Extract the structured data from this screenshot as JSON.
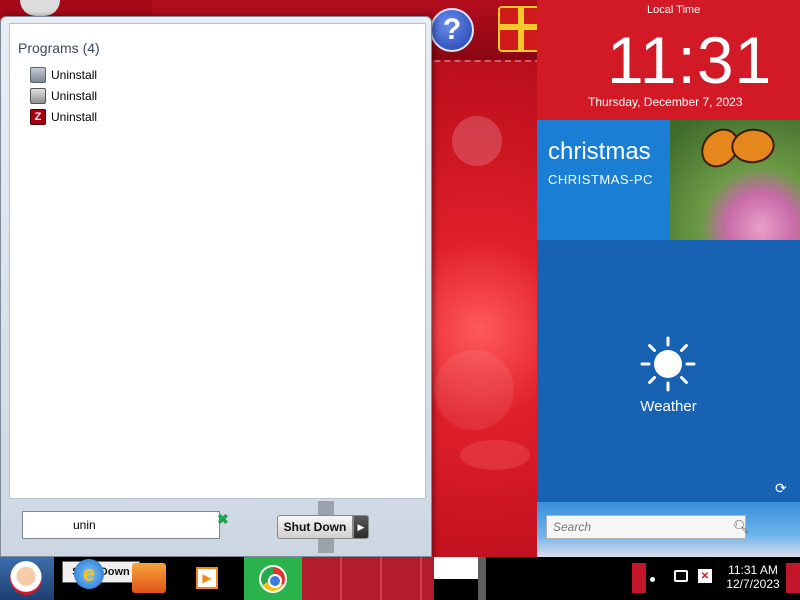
{
  "start_menu": {
    "programs_heading": "Programs (4)",
    "results": [
      {
        "label": "Uninstall",
        "icon": "disk-uninstall-icon"
      },
      {
        "label": "Uninstall",
        "icon": "cd-uninstall-icon"
      },
      {
        "label": "Uninstall",
        "icon": "filezilla-uninstall-icon"
      }
    ],
    "search_value": "unin",
    "shutdown_label": "Shut Down"
  },
  "clock": {
    "label": "Local Time",
    "time": "11:31",
    "date": "Thursday, December 7, 2023"
  },
  "tiles": {
    "user_name": "christmas",
    "pc_name": "CHRISTMAS-PC",
    "weather_label": "Weather",
    "search_placeholder": "Search"
  },
  "dock": {
    "help_glyph": "?"
  },
  "taskbar": {
    "shutdown_preview": "Shut Down",
    "ie_glyph": "e",
    "media_glyph": "▶",
    "tray_time": "11:31 AM",
    "tray_date": "12/7/2023"
  },
  "colors": {
    "accent_red": "#d11a25",
    "tile_blue": "#1a7fd4",
    "weather_blue": "#1862b4",
    "chrome_green": "#2ab34a"
  }
}
